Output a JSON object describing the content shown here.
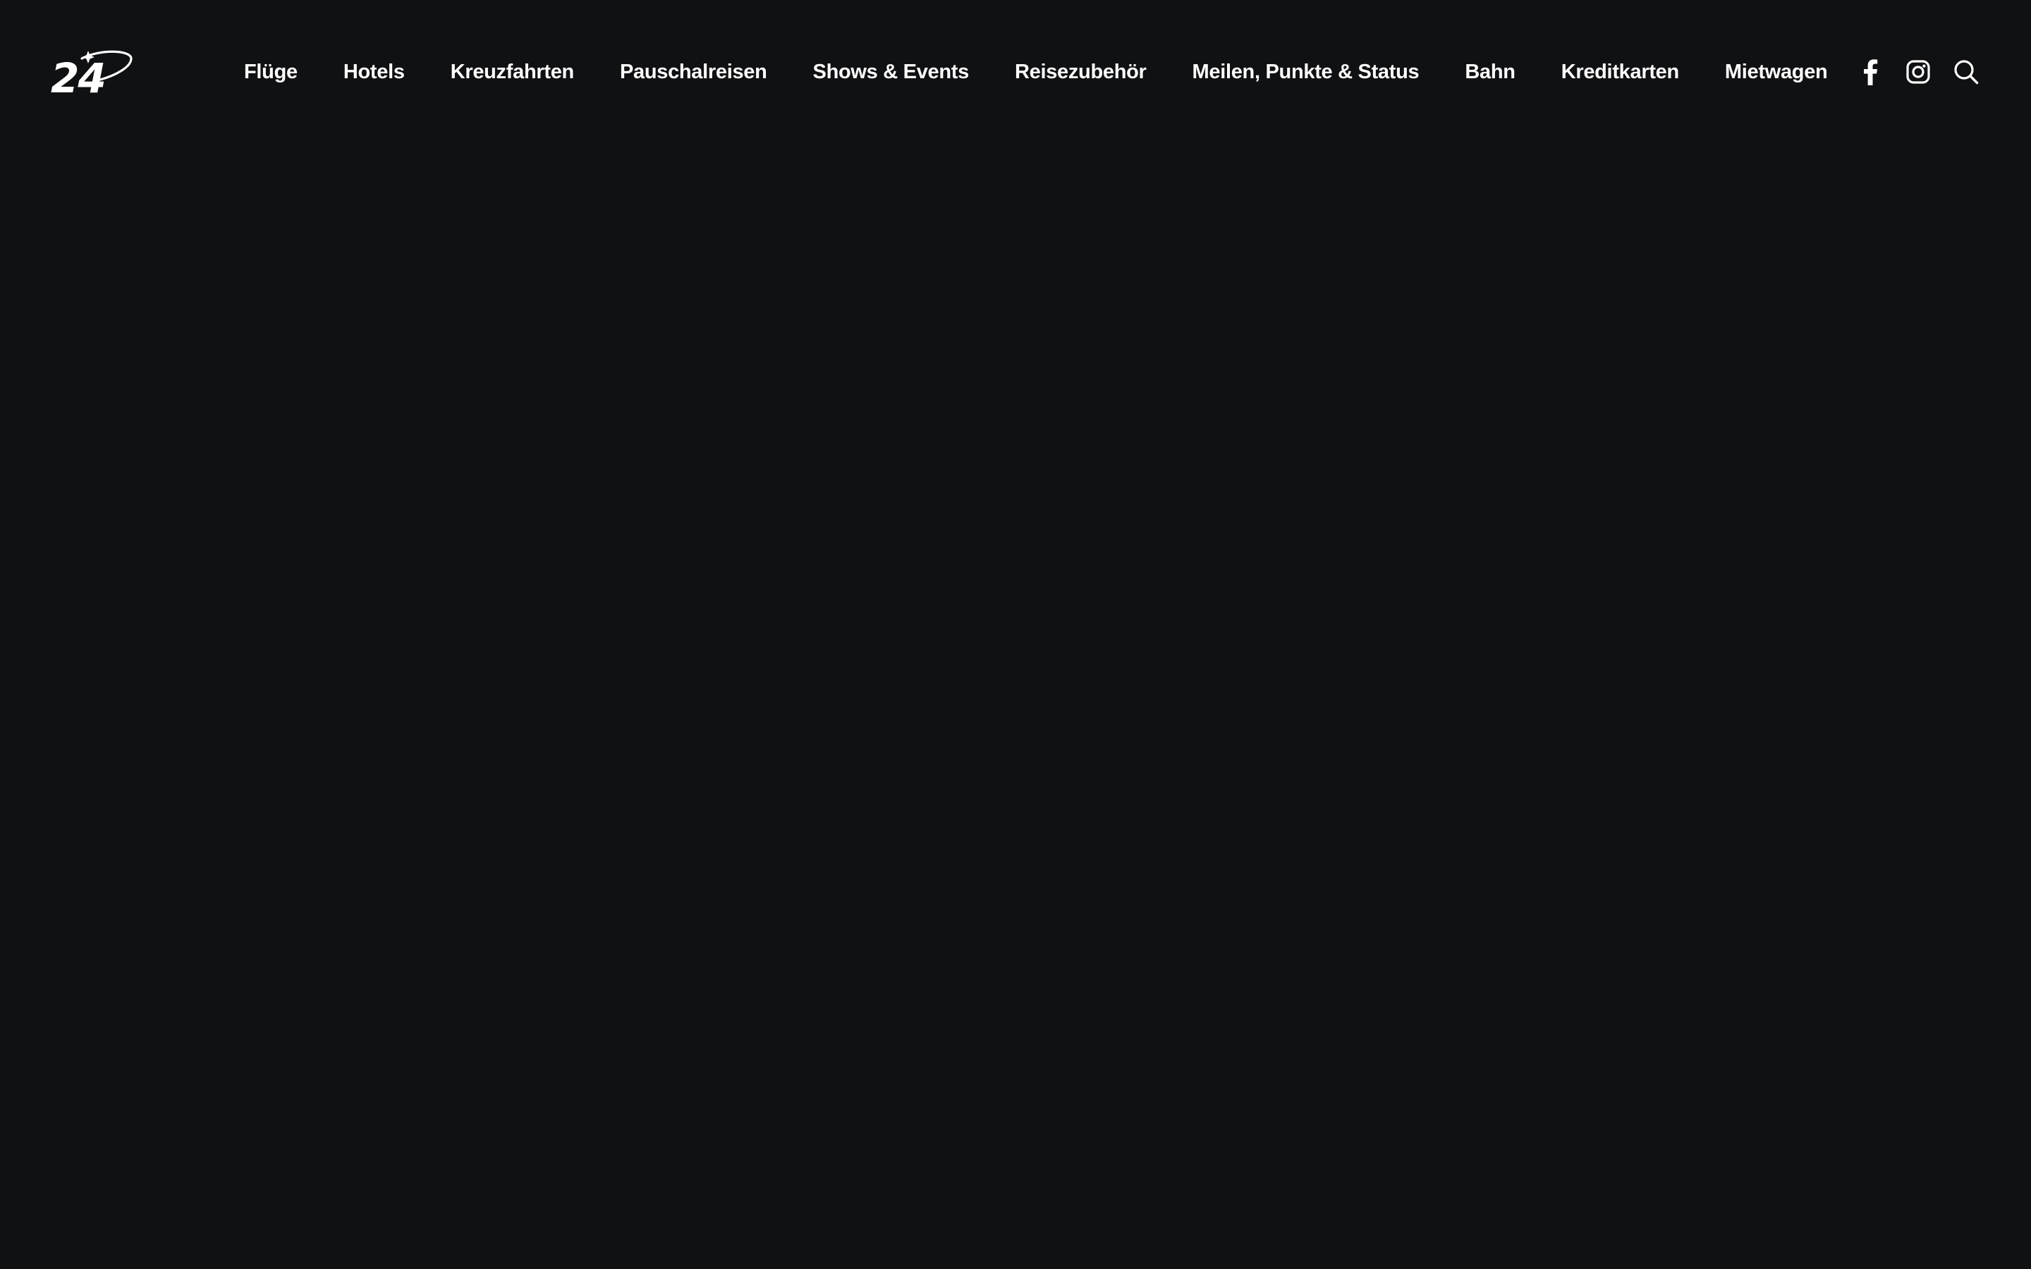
{
  "brand": {
    "logo_text": "24",
    "logo_icon": "plane-orbit-logo-icon"
  },
  "nav": {
    "items": [
      {
        "label": "Flüge"
      },
      {
        "label": "Hotels"
      },
      {
        "label": "Kreuzfahrten"
      },
      {
        "label": "Pauschalreisen"
      },
      {
        "label": "Shows & Events"
      },
      {
        "label": "Reisezubehör"
      },
      {
        "label": "Meilen, Punkte & Status"
      },
      {
        "label": "Bahn"
      },
      {
        "label": "Kreditkarten"
      },
      {
        "label": "Mietwagen"
      }
    ]
  },
  "tools": {
    "icons": [
      "facebook-icon",
      "instagram-icon",
      "search-icon"
    ]
  },
  "colors": {
    "background": "#101113",
    "text": "#ffffff"
  }
}
